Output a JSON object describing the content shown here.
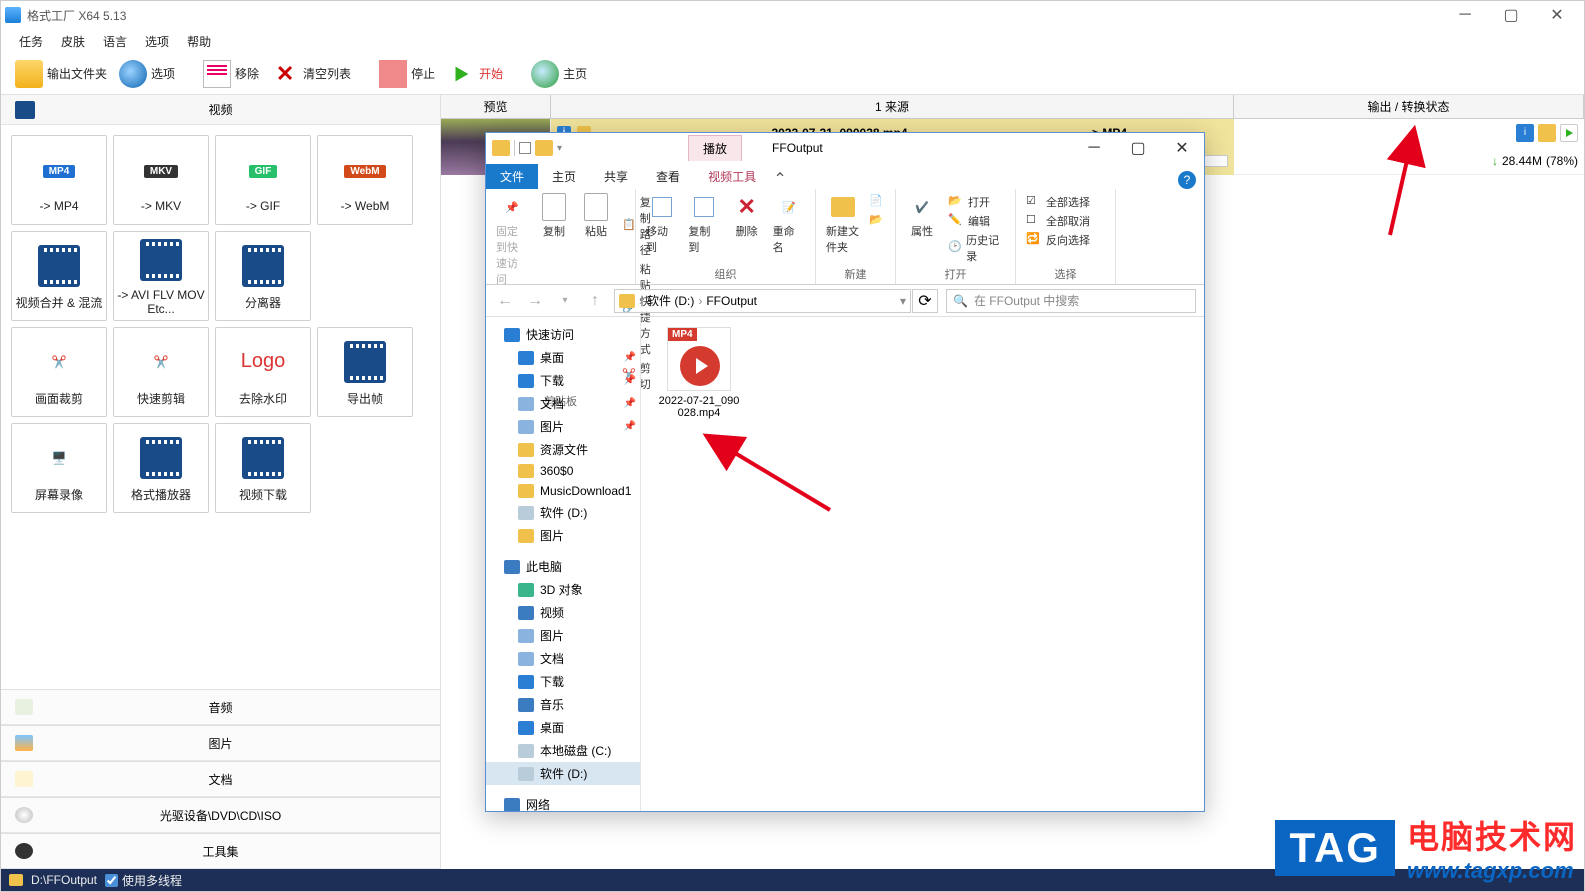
{
  "app": {
    "title": "格式工厂 X64 5.13",
    "menu": [
      "任务",
      "皮肤",
      "语言",
      "选项",
      "帮助"
    ],
    "toolbar": {
      "output_folder": "输出文件夹",
      "options": "选项",
      "remove": "移除",
      "clear": "清空列表",
      "stop": "停止",
      "start": "开始",
      "home": "主页"
    },
    "left": {
      "video_header": "视频",
      "tools": {
        "mp4": "-> MP4",
        "mkv": "-> MKV",
        "gif": "-> GIF",
        "webm": "-> WebM",
        "merge": "视频合并 & 混流",
        "avi": "-> AVI FLV MOV Etc...",
        "split": "分离器",
        "crop": "画面裁剪",
        "quickcut": "快速剪辑",
        "watermark": "去除水印",
        "export_frames": "导出帧",
        "screenrec": "屏幕录像",
        "player": "格式播放器",
        "download": "视频下载"
      },
      "categories": {
        "audio": "音频",
        "image": "图片",
        "document": "文档",
        "disc": "光驱设备\\DVD\\CD\\ISO",
        "tools": "工具集"
      }
    },
    "right": {
      "columns": {
        "preview": "预览",
        "source": "1 来源",
        "status": "输出 / 转换状态"
      },
      "task": {
        "filename": "2022-07-21_090028.mp4",
        "format": "-> MP4",
        "size": "28.44M",
        "progress": "(78%)"
      }
    },
    "statusbar": {
      "path": "D:\\FFOutput",
      "multithread": "使用多线程"
    }
  },
  "explorer": {
    "window_title": "FFOutput",
    "play_tab": "播放",
    "ribbon_tabs": {
      "file": "文件",
      "home": "主页",
      "share": "共享",
      "view": "查看",
      "video_tools": "视频工具"
    },
    "ribbon": {
      "pin": "固定到快速访问",
      "copy": "复制",
      "paste": "粘贴",
      "copy_path": "复制路径",
      "paste_shortcut": "粘贴快捷方式",
      "cut": "剪切",
      "clipboard_group": "剪贴板",
      "move_to": "移动到",
      "copy_to": "复制到",
      "delete": "删除",
      "rename": "重命名",
      "organize_group": "组织",
      "new_folder": "新建文件夹",
      "new_group": "新建",
      "properties": "属性",
      "open": "打开",
      "edit": "编辑",
      "history": "历史记录",
      "open_group": "打开",
      "select_all": "全部选择",
      "select_none": "全部取消",
      "invert": "反向选择",
      "select_group": "选择"
    },
    "address": {
      "drive": "软件 (D:)",
      "folder": "FFOutput",
      "search_placeholder": "在 FFOutput 中搜索"
    },
    "nav": {
      "quick_access": "快速访问",
      "desktop": "桌面",
      "downloads": "下载",
      "documents": "文档",
      "pictures": "图片",
      "resources": "资源文件",
      "three60": "360$0",
      "musicdl": "MusicDownload1",
      "drive_d": "软件 (D:)",
      "pictures2": "图片",
      "this_pc": "此电脑",
      "threeD": "3D 对象",
      "videos": "视频",
      "pictures3": "图片",
      "documents2": "文档",
      "downloads2": "下载",
      "music": "音乐",
      "desktop2": "桌面",
      "local_c": "本地磁盘 (C:)",
      "drive_d2": "软件 (D:)",
      "network": "网络"
    },
    "file": {
      "badge": "MP4",
      "name_line1": "2022-07-21_090",
      "name_line2": "028.mp4"
    }
  },
  "watermark": {
    "tag": "TAG",
    "big": "电脑技术网",
    "url": "www.tagxp.com"
  }
}
